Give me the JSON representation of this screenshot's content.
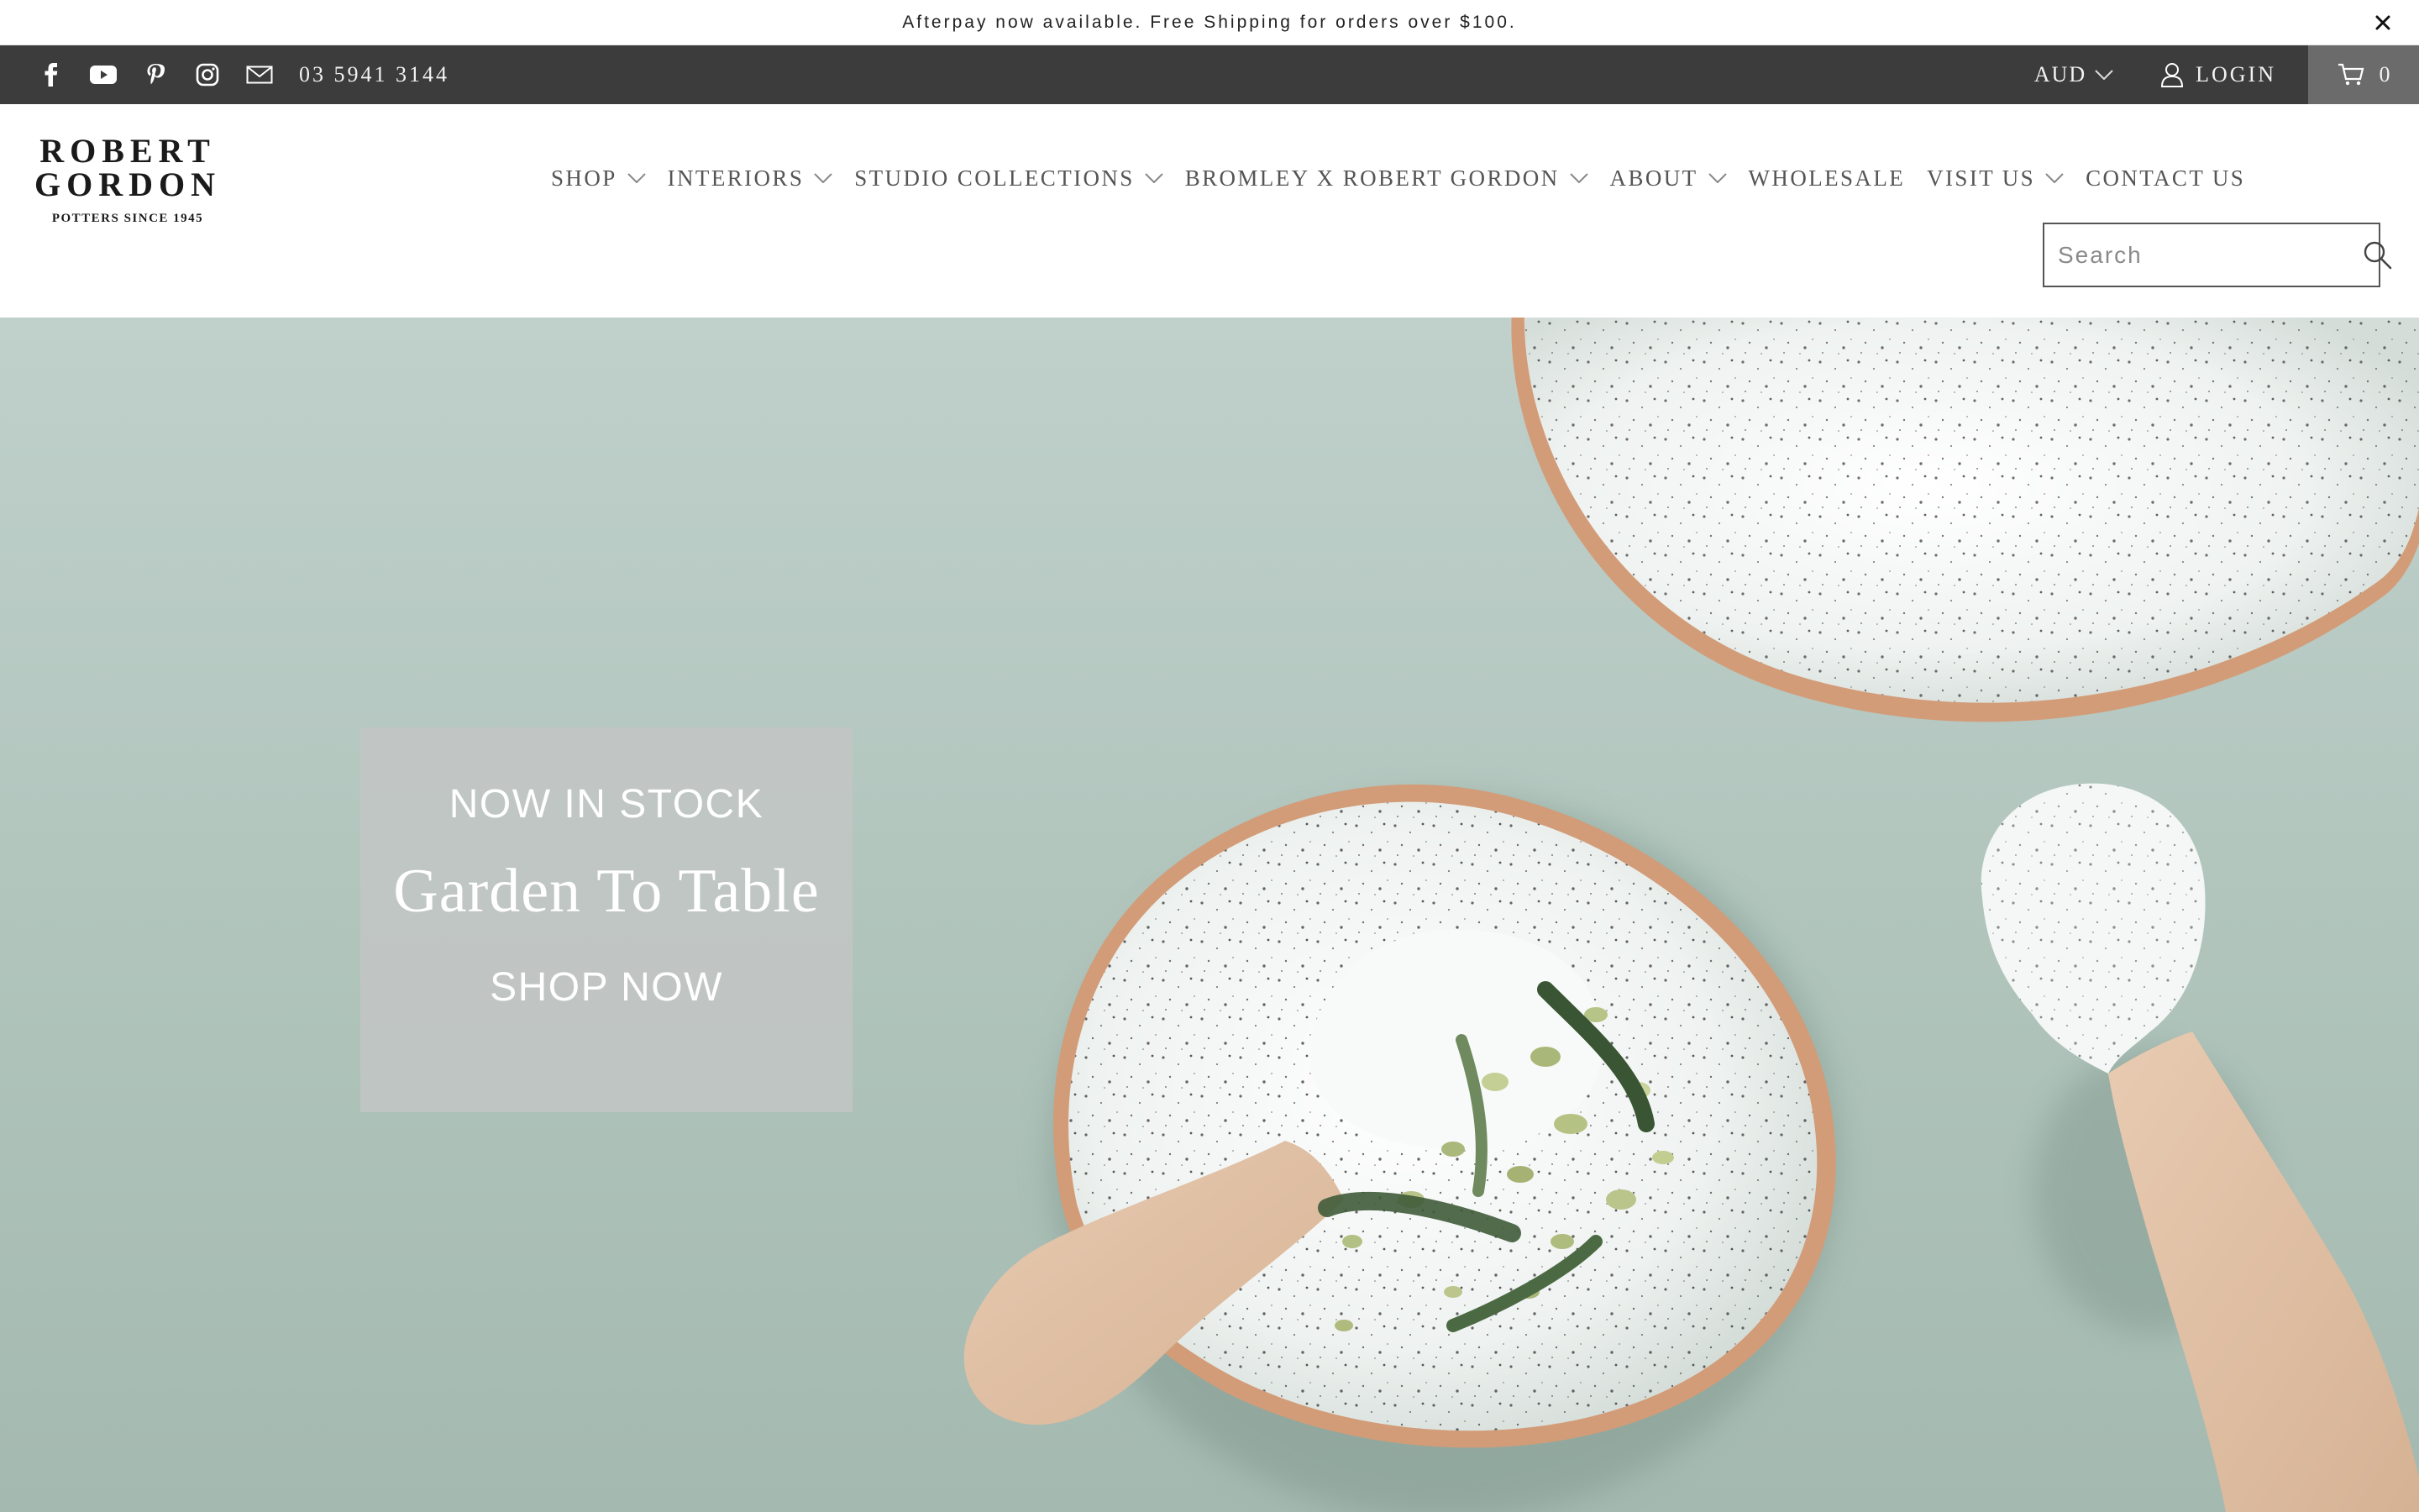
{
  "announcement": {
    "text": "Afterpay now available. Free Shipping for orders over $100.",
    "close_icon": "close-icon"
  },
  "topbar": {
    "social_icons": [
      "facebook-icon",
      "youtube-icon",
      "pinterest-icon",
      "instagram-icon",
      "mail-icon"
    ],
    "phone": "03 5941 3144",
    "currency": "AUD",
    "login_label": "LOGIN",
    "cart_count": "0"
  },
  "logo": {
    "line1": "ROBERT",
    "line2": "GORDON",
    "line3": "POTTERS SINCE 1945"
  },
  "nav": {
    "items": [
      {
        "label": "SHOP",
        "has_dropdown": true
      },
      {
        "label": "INTERIORS",
        "has_dropdown": true
      },
      {
        "label": "STUDIO COLLECTIONS",
        "has_dropdown": true
      },
      {
        "label": "BROMLEY X ROBERT GORDON",
        "has_dropdown": true
      },
      {
        "label": "ABOUT",
        "has_dropdown": true
      },
      {
        "label": "WHOLESALE",
        "has_dropdown": false
      },
      {
        "label": "VISIT US",
        "has_dropdown": true
      },
      {
        "label": "CONTACT US",
        "has_dropdown": false
      }
    ]
  },
  "search": {
    "placeholder": "Search",
    "value": ""
  },
  "hero": {
    "subtitle": "NOW IN STOCK",
    "title": "Garden To Table",
    "button_label": "SHOP NOW"
  },
  "colors": {
    "topbar_bg": "#3c3c3c",
    "cart_bg": "#6b6b6b",
    "hero_bg": "#b2c6be",
    "nav_text": "#555555"
  }
}
